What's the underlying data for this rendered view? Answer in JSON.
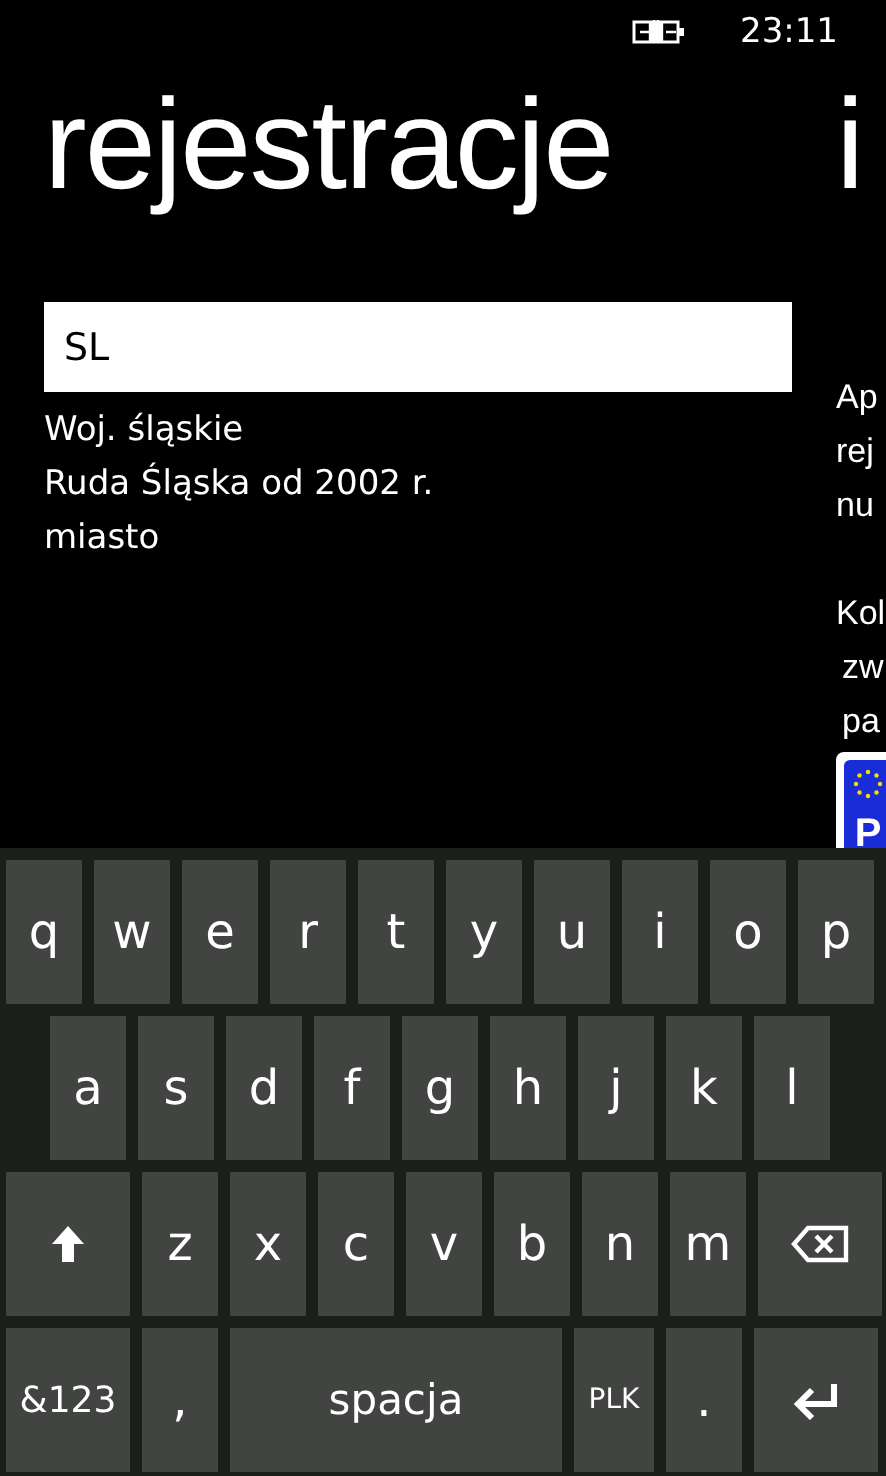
{
  "status_bar": {
    "time": "23:11"
  },
  "panels": [
    {
      "title": "rejestracje",
      "search": {
        "value": "SL"
      },
      "result": [
        "Woj. śląskie",
        "Ruda Śląska od 2002 r.",
        "miasto"
      ]
    },
    {
      "title": "i",
      "paragraphs": [
        [
          "Ap",
          "rej",
          "nu"
        ],
        [
          "Kol",
          "zw",
          "pa"
        ]
      ],
      "plate": {
        "code": "P"
      }
    }
  ],
  "keyboard": {
    "rows": [
      {
        "keys": [
          {
            "kind": "letter",
            "label": "q"
          },
          {
            "kind": "letter",
            "label": "w"
          },
          {
            "kind": "letter",
            "label": "e"
          },
          {
            "kind": "letter",
            "label": "r"
          },
          {
            "kind": "letter",
            "label": "t"
          },
          {
            "kind": "letter",
            "label": "y"
          },
          {
            "kind": "letter",
            "label": "u"
          },
          {
            "kind": "letter",
            "label": "i"
          },
          {
            "kind": "letter",
            "label": "o"
          },
          {
            "kind": "letter",
            "label": "p"
          }
        ]
      },
      {
        "keys": [
          {
            "kind": "letter",
            "label": "a"
          },
          {
            "kind": "letter",
            "label": "s"
          },
          {
            "kind": "letter",
            "label": "d"
          },
          {
            "kind": "letter",
            "label": "f"
          },
          {
            "kind": "letter",
            "label": "g"
          },
          {
            "kind": "letter",
            "label": "h"
          },
          {
            "kind": "letter",
            "label": "j"
          },
          {
            "kind": "letter",
            "label": "k"
          },
          {
            "kind": "letter",
            "label": "l"
          }
        ]
      },
      {
        "keys": [
          {
            "kind": "shift"
          },
          {
            "kind": "letter",
            "label": "z"
          },
          {
            "kind": "letter",
            "label": "x"
          },
          {
            "kind": "letter",
            "label": "c"
          },
          {
            "kind": "letter",
            "label": "v"
          },
          {
            "kind": "letter",
            "label": "b"
          },
          {
            "kind": "letter",
            "label": "n"
          },
          {
            "kind": "letter",
            "label": "m"
          },
          {
            "kind": "backspace"
          }
        ]
      },
      {
        "keys": [
          {
            "kind": "symbols",
            "label": "&123"
          },
          {
            "kind": "letter",
            "label": ","
          },
          {
            "kind": "space",
            "label": "spacja"
          },
          {
            "kind": "lang",
            "label": "PLK"
          },
          {
            "kind": "letter",
            "label": "."
          },
          {
            "kind": "enter"
          }
        ]
      }
    ]
  }
}
